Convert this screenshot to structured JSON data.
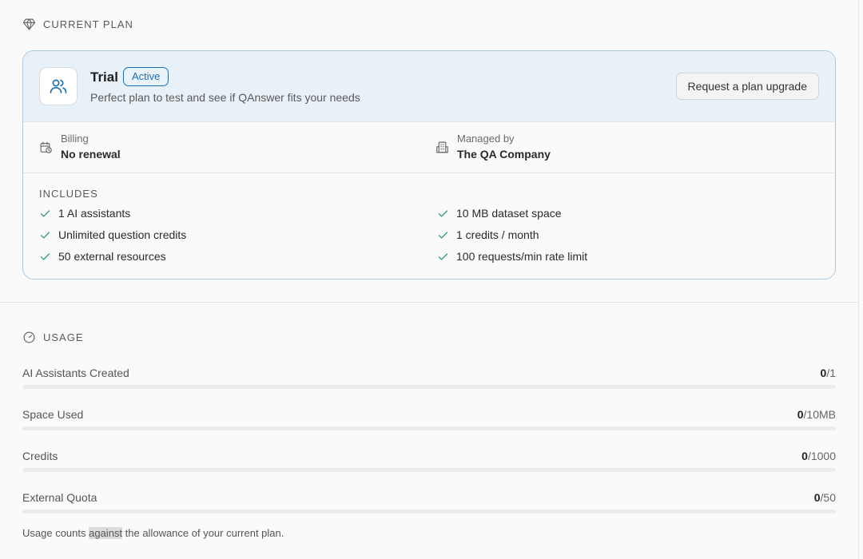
{
  "plan_section": {
    "title": "CURRENT PLAN"
  },
  "plan": {
    "name": "Trial",
    "status": "Active",
    "description": "Perfect plan to test and see if QAnswer fits your needs",
    "upgrade_label": "Request a plan upgrade",
    "billing": {
      "label": "Billing",
      "value": "No renewal"
    },
    "managed": {
      "label": "Managed by",
      "value": "The QA Company"
    },
    "includes_title": "INCLUDES",
    "features": [
      "1 AI assistants",
      "Unlimited question credits",
      "50 external resources",
      "10 MB dataset space",
      "1 credits / month",
      "100 requests/min rate limit"
    ]
  },
  "usage_section": {
    "title": "USAGE"
  },
  "usage": [
    {
      "label": "AI Assistants Created",
      "used": "0",
      "limit": "/1",
      "fraction": 0
    },
    {
      "label": "Space Used",
      "used": "0",
      "limit": "/10MB",
      "fraction": 0
    },
    {
      "label": "Credits",
      "used": "0",
      "limit": "/1000",
      "fraction": 0
    },
    {
      "label": "External Quota",
      "used": "0",
      "limit": "/50",
      "fraction": 0
    }
  ],
  "footnote": {
    "before": "Usage counts ",
    "highlight": "against",
    "after": " the allowance of your current plan."
  },
  "colors": {
    "accent": "#1e6fb0",
    "check": "#2e9e6e",
    "card_border": "#a9c9e3",
    "card_header": "#e8f0f8"
  }
}
